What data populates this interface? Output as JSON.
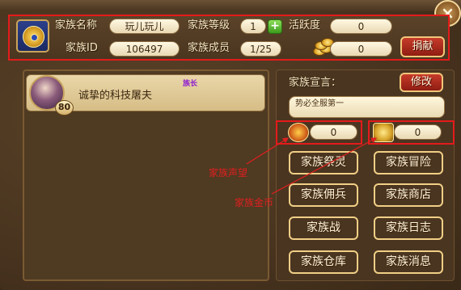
{
  "window": {
    "close_label": "×"
  },
  "info": {
    "name_label": "家族名称",
    "name_value": "玩儿玩儿",
    "level_label": "家族等级",
    "level_value": "1",
    "plus_label": "+",
    "activity_label": "活跃度",
    "activity_value": "0",
    "id_label": "家族ID",
    "id_value": "106497",
    "members_label": "家族成员",
    "members_value": "1/25",
    "gold_value": "0",
    "donate_label": "捐献"
  },
  "member": {
    "name": "诚挚的科技屠夫",
    "role": "族长",
    "level": "80"
  },
  "declaration": {
    "label": "家族宣言：",
    "edit_label": "修改",
    "text": "势必全服第一"
  },
  "stats": {
    "honor_value": "0",
    "money_value": "0"
  },
  "functions": {
    "buttons": [
      {
        "label": "家族祭灵",
        "style": "orange"
      },
      {
        "label": "家族冒险",
        "style": "orange"
      },
      {
        "label": "家族佣兵",
        "style": "grey"
      },
      {
        "label": "家族商店",
        "style": "orange"
      },
      {
        "label": "家族战",
        "style": "grey"
      },
      {
        "label": "家族日志",
        "style": "orange"
      },
      {
        "label": "家族仓库",
        "style": "orange"
      },
      {
        "label": "家族消息",
        "style": "orange"
      }
    ]
  },
  "annotations": {
    "honor_note": "家族声望",
    "money_note": "家族金币"
  },
  "colors": {
    "highlight_box": "#e41b1b",
    "annotation_text": "#e21f1f",
    "leader_role": "#8e1fd0"
  }
}
